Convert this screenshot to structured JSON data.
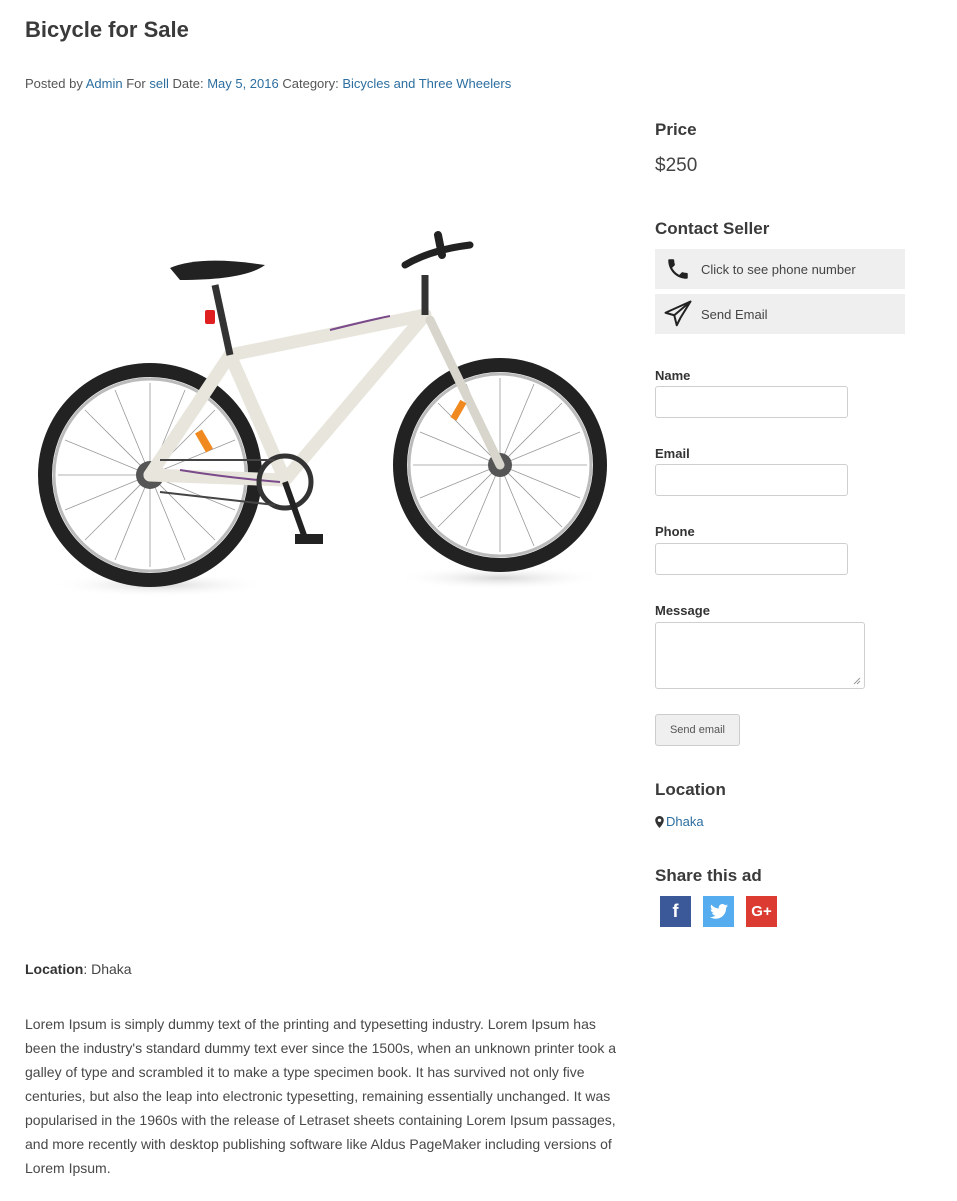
{
  "listing": {
    "title": "Bicycle for Sale",
    "meta": {
      "posted_by_label": "Posted by",
      "author": "Admin",
      "for_label": "For",
      "for_value": "sell",
      "date_label": "Date:",
      "date": "May 5, 2016",
      "category_label": "Category:",
      "category": "Bicycles and Three Wheelers"
    },
    "location_label": "Location",
    "location_value": "Dhaka",
    "description": "Lorem Ipsum is simply dummy text of the printing and typesetting industry. Lorem Ipsum has been the industry's standard dummy text ever since the 1500s, when an unknown printer took a galley of type and scrambled it to make a type specimen book. It has survived not only five centuries, but also the leap into electronic typesetting, remaining essentially unchanged. It was popularised in the 1960s with the release of Letraset sheets containing Lorem Ipsum passages, and more recently with desktop publishing software like Aldus PageMaker including versions of Lorem Ipsum."
  },
  "sidebar": {
    "price_heading": "Price",
    "price": "$250",
    "contact_heading": "Contact Seller",
    "phone_button": "Click to see phone number",
    "email_button": "Send Email",
    "form": {
      "name_label": "Name",
      "email_label": "Email",
      "phone_label": "Phone",
      "message_label": "Message",
      "submit_label": "Send email"
    },
    "location_heading": "Location",
    "location_link": "Dhaka",
    "share_heading": "Share this ad",
    "share_icons": [
      "facebook-icon",
      "twitter-icon",
      "google-plus-icon"
    ]
  },
  "colors": {
    "link": "#2c6ea0",
    "facebook": "#3b5998",
    "twitter": "#55acee",
    "google_plus": "#dc3b31",
    "button_bg": "#efefef"
  }
}
